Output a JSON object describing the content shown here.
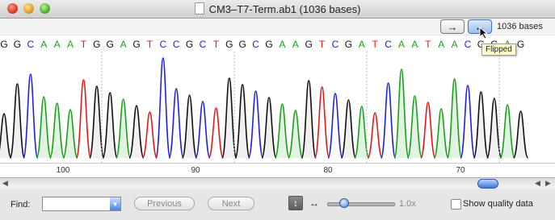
{
  "window": {
    "title": "CM3–T7-Term.ab1  (1036 bases)"
  },
  "toolbar": {
    "forward_icon": "arrow-right-icon",
    "reverse_icon": "arrow-left-icon",
    "bases_label": "1036 bases",
    "tooltip": "Flipped"
  },
  "sequence": {
    "bases": [
      "G",
      "G",
      "C",
      "A",
      "A",
      "A",
      "T",
      "G",
      "G",
      "A",
      "G",
      "T",
      "C",
      "C",
      "G",
      "C",
      "T",
      "G",
      "G",
      "C",
      "G",
      "A",
      "A",
      "G",
      "T",
      "C",
      "G",
      "A",
      "T",
      "C",
      "A",
      "A",
      "T",
      "A",
      "A",
      "C",
      "G",
      "G",
      "A",
      "G"
    ],
    "colors": {
      "A": "#1aa01a",
      "C": "#2020e0",
      "G": "#111111",
      "T": "#e01a1a"
    }
  },
  "ruler": {
    "ticks": [
      {
        "label": "100",
        "value": 100
      },
      {
        "label": "90",
        "value": 90
      },
      {
        "label": "80",
        "value": 80
      },
      {
        "label": "70",
        "value": 70
      }
    ]
  },
  "find": {
    "label": "Find:",
    "value": "",
    "previous_label": "Previous",
    "next_label": "Next"
  },
  "zoom": {
    "value_label": "1.0x",
    "level": 0.25
  },
  "quality": {
    "label": "Show quality data",
    "checked": false
  },
  "scroll": {
    "position": 0.87
  }
}
